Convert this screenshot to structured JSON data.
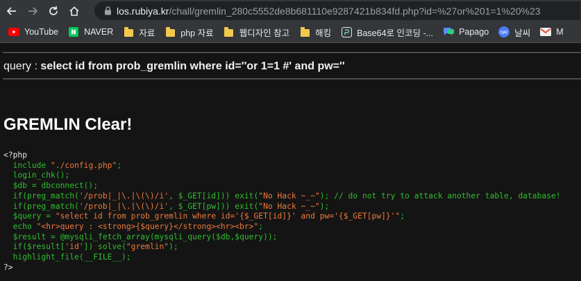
{
  "browser": {
    "url_host": "los.rubiya.kr",
    "url_rest": "/chall/gremlin_280c5552de8b681110e9287421b834fd.php?id=%27or%201=1%20%23",
    "bookmarks": [
      {
        "label": "YouTube",
        "icon": "youtube-icon"
      },
      {
        "label": "NAVER",
        "icon": "naver-icon"
      },
      {
        "label": "자료",
        "icon": "folder-icon"
      },
      {
        "label": "php 자료",
        "icon": "folder-icon"
      },
      {
        "label": "웹디자인 참고",
        "icon": "folder-icon"
      },
      {
        "label": "해킹",
        "icon": "folder-icon"
      },
      {
        "label": "Base64로 인코딩 -...",
        "icon": "base64-icon"
      },
      {
        "label": "Papago",
        "icon": "papago-icon"
      },
      {
        "label": "날씨",
        "icon": "weather-icon"
      },
      {
        "label": "M",
        "icon": "gmail-icon"
      }
    ]
  },
  "page": {
    "query_prefix": "query : ",
    "query_sql": "select id from prob_gremlin where id=''or 1=1 #' and pw=''",
    "clear_title": "GREMLIN Clear!"
  },
  "source": {
    "open_tag": "<?php",
    "close_tag": "?>",
    "l1a": "include ",
    "l1b": "\"./config.php\"",
    "l1c": ";",
    "l2": "login_chk();",
    "l3": "$db = dbconnect();",
    "l4a": "if(preg_match(",
    "l4b": "'/prob|_|\\.|\\(\\)/i'",
    "l4c": ", $_GET[id])) exit(",
    "l4d": "\"No Hack ~_~\"",
    "l4e": "); // do not try to attack another table, database!",
    "l5a": "if(preg_match(",
    "l5b": "'/prob|_|\\.|\\(\\)/i'",
    "l5c": ", $_GET[pw])) exit(",
    "l5d": "\"No Hack ~_~\"",
    "l5e": ");",
    "l6a": "$query = ",
    "l6b": "\"select id from prob_gremlin where id='{$_GET[id]}' and pw='{$_GET[pw]}'\"",
    "l6c": ";",
    "l7a": "echo ",
    "l7b": "\"<hr>query : <strong>{$query}</strong><hr><br>\"",
    "l7c": ";",
    "l8": "$result = @mysqli_fetch_array(mysqli_query($db,$query));",
    "l9a": "if($result[",
    "l9b": "'id'",
    "l9c": "]) solve(",
    "l9d": "\"gremlin\"",
    "l9e": ");",
    "l10": "highlight_file(__FILE__);"
  },
  "colors": {
    "browser_bar": "#35363a",
    "omnibox": "#202124",
    "page_bg": "#141414",
    "code_keyword": "#2fbf2f",
    "code_string": "#f07a3a"
  }
}
